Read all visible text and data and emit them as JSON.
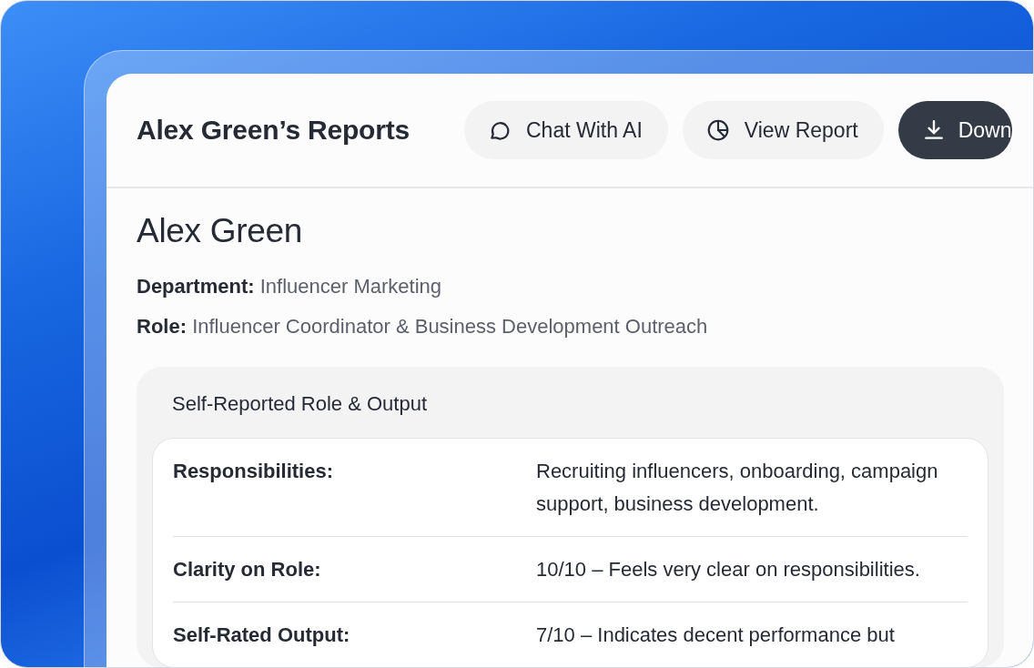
{
  "header": {
    "title": "Alex Green’s Reports",
    "buttons": [
      {
        "label": "Chat With AI",
        "kind": "chat"
      },
      {
        "label": "View Report",
        "kind": "report"
      },
      {
        "label": "Down",
        "kind": "download"
      }
    ]
  },
  "profile": {
    "name": "Alex Green",
    "fields": [
      {
        "label": "Department:",
        "value": "Influencer Marketing"
      },
      {
        "label": "Role:",
        "value": "Influencer Coordinator & Business Development Outreach"
      }
    ]
  },
  "section": {
    "title": "Self-Reported Role & Output",
    "rows": [
      {
        "label": "Responsibilities:",
        "value": "Recruiting influencers, onboarding, campaign support, business development."
      },
      {
        "label": "Clarity on Role:",
        "value": "10/10 – Feels very clear on responsibilities."
      },
      {
        "label": "Self-Rated Output:",
        "value": "7/10 – Indicates decent performance but"
      }
    ]
  }
}
